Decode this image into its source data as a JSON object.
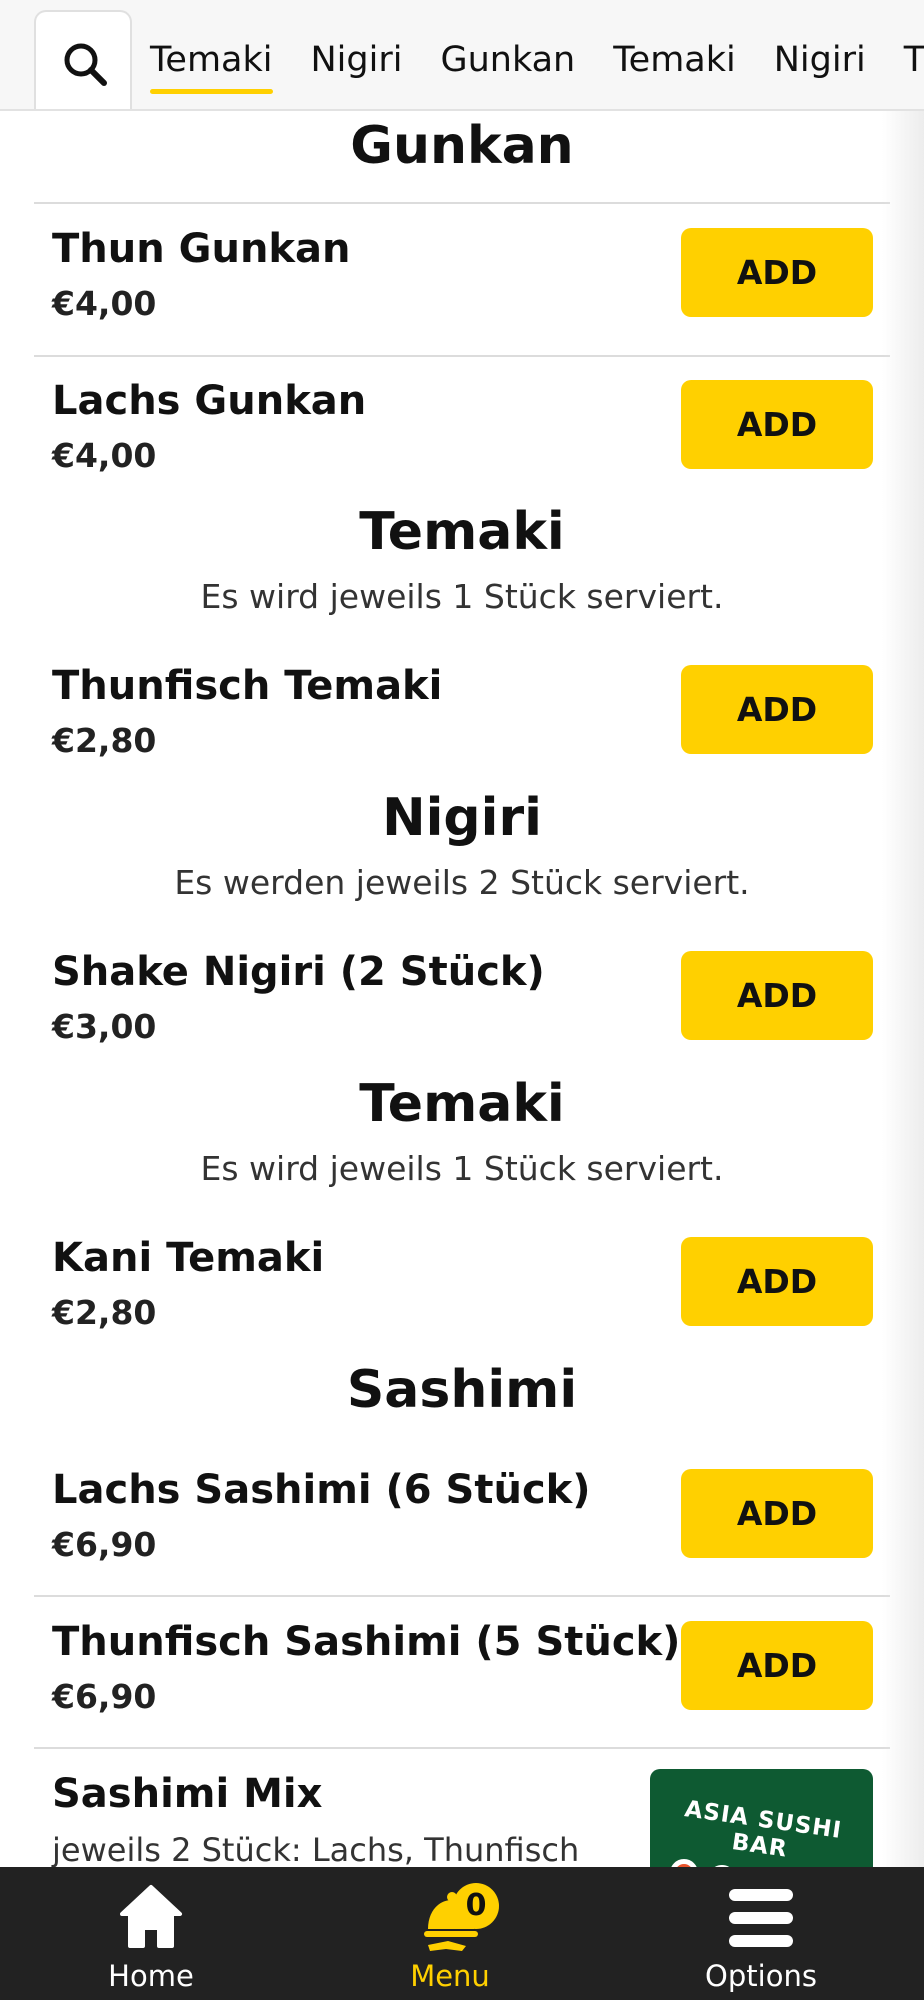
{
  "tabs": [
    "Temaki",
    "Nigiri",
    "Gunkan",
    "Temaki",
    "Nigiri",
    "T"
  ],
  "sections": {
    "gunkan": {
      "title": "Gunkan"
    },
    "temaki1": {
      "title": "Temaki",
      "description": "Es wird jeweils 1 Stück serviert."
    },
    "nigiri": {
      "title": "Nigiri",
      "description": "Es werden jeweils 2 Stück serviert."
    },
    "temaki2": {
      "title": "Temaki",
      "description": "Es wird jeweils 1 Stück serviert."
    },
    "sashimi": {
      "title": "Sashimi"
    }
  },
  "items": [
    {
      "name": "Thun Gunkan",
      "price": "€4,00"
    },
    {
      "name": "Lachs Gunkan",
      "price": "€4,00"
    },
    {
      "name": "Thunfisch Temaki",
      "price": "€2,80"
    },
    {
      "name": "Shake Nigiri (2 Stück)",
      "price": "€3,00"
    },
    {
      "name": "Kani Temaki",
      "price": "€2,80"
    },
    {
      "name": "Lachs Sashimi (6 Stück)",
      "price": "€6,90"
    },
    {
      "name": "Thunfisch Sashimi (5 Stück)",
      "price": "€6,90"
    },
    {
      "name": "Sashimi Mix",
      "description": "jeweils 2 Stück: Lachs, Thunfisch",
      "image_text": "ASIA SUSHI BAR"
    }
  ],
  "add_label": "ADD",
  "bottom_nav": {
    "home": "Home",
    "menu": "Menu",
    "options": "Options",
    "cart_count": "0"
  },
  "colors": {
    "accent": "#ffd000",
    "bottom_bar": "#222222",
    "text": "#111111"
  },
  "icons": {
    "search": "search-icon",
    "home": "home-icon",
    "menu": "serving-bell-icon",
    "options": "hamburger-icon"
  }
}
